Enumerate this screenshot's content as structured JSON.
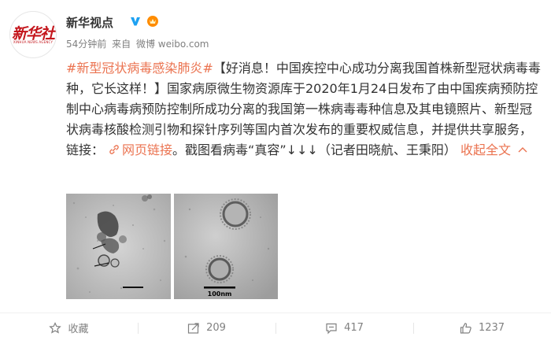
{
  "author": {
    "name": "新华视点",
    "avatar_logo": "新华社",
    "avatar_sub": "XINHUA NEWS AGENCY"
  },
  "meta": {
    "time": "54分钟前",
    "from_label": "来自",
    "source": "微博 weibo.com"
  },
  "post": {
    "hashtag": "#新型冠状病毒感染肺炎#",
    "body_1": "【好消息！中国疾控中心成功分离我国首株新型冠状病毒毒种，它长这样！】国家病原微生物资源库于2020年1月24日发布了由中国疾病预防控制中心病毒病预防控制所成功分离的我国第一株病毒毒种信息及其电镜照片、新型冠状病毒核酸检测引物和探针序列等国内首次发布的重要权威信息，并提供共享服务，链接：",
    "link_label": "网页链接",
    "body_2": "。戳图看病毒“真容”↓↓↓（记者田晓航、王秉阳）",
    "collapse_label": "收起全文",
    "scale_label": "100nm"
  },
  "actions": {
    "favorite": "收藏",
    "repost": "209",
    "comment": "417",
    "like": "1237"
  },
  "colors": {
    "link": "#eb7350",
    "verified": "#1da1f2",
    "text": "#333333",
    "muted": "#808080"
  }
}
